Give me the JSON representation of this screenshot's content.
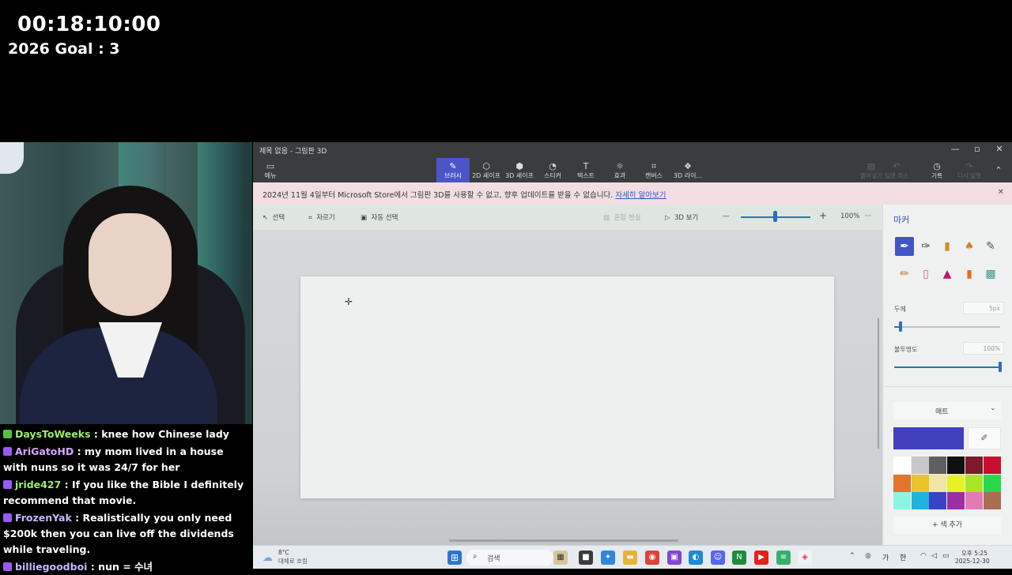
{
  "overlay": {
    "timer": "00:18:10:00",
    "goal": "2026 Goal : 3"
  },
  "chat": [
    {
      "user": "DaysToWeeks",
      "text": " : knee how Chinese lady",
      "user_color": "#9bf06b",
      "badge_color": "#52c33b"
    },
    {
      "user": "AriGatoHD",
      "text": " : my mom lived in a house with nuns so it was 24/7 for her",
      "user_color": "#d8a8ff",
      "badge_color": "#9b59f5"
    },
    {
      "user": "jride427",
      "text": " : If you like the Bible I definitely recommend that movie.",
      "user_color": "#9bf06b",
      "badge_color": "#9b59f5"
    },
    {
      "user": "FrozenYak",
      "text": " : Realistically you only need $200k then you can live off the dividends while traveling.",
      "user_color": "#c8b8ff",
      "badge_color": "#9b59f5"
    },
    {
      "user": "billiegoodboi",
      "text": " : nun = 수녀",
      "user_color": "#c8b8ff",
      "badge_color": "#9b59f5"
    }
  ],
  "window": {
    "title": "제목 없음 - 그림판 3D",
    "controls": {
      "minimize": "—",
      "maximize": "▫",
      "close": "✕"
    }
  },
  "toolbar": {
    "menu": {
      "label": "메뉴",
      "icon": "folder-icon"
    },
    "items": [
      {
        "label": "브러시",
        "icon": "brush-icon",
        "active": true
      },
      {
        "label": "2D 셰이프",
        "icon": "2d-shapes-icon",
        "active": false
      },
      {
        "label": "3D 셰이프",
        "icon": "3d-shapes-icon",
        "active": false
      },
      {
        "label": "스티커",
        "icon": "sticker-icon",
        "active": false
      },
      {
        "label": "텍스트",
        "icon": "text-icon",
        "active": false
      },
      {
        "label": "효과",
        "icon": "effects-icon",
        "active": false
      },
      {
        "label": "캔버스",
        "icon": "canvas-icon",
        "active": false
      },
      {
        "label": "3D 라이...",
        "icon": "3d-library-icon",
        "active": false
      }
    ],
    "right": [
      {
        "label": "붙여넣기",
        "icon": "paste-icon",
        "enabled": false
      },
      {
        "label": "실행 취소",
        "icon": "undo-icon",
        "enabled": false
      },
      {
        "label": "기록",
        "icon": "history-icon",
        "enabled": true
      },
      {
        "label": "다시 실행",
        "icon": "redo-icon",
        "enabled": false
      }
    ]
  },
  "banner": {
    "text": "2024년 11월 4일부터 Microsoft Store에서 그림판 3D를 사용할 수 없고, 향후 업데이트를 받을 수 없습니다.",
    "link": "자세히 알아보기",
    "close": "✕"
  },
  "subbar": {
    "select": "선택",
    "crop": "자르기",
    "magic_select": "자동 선택",
    "mixed_reality": "혼합 현실",
    "view_3d": "3D 보기",
    "zoom_minus": "—",
    "zoom_plus": "+",
    "zoom_value": "100%",
    "more": "···",
    "zoom_level": 0.5
  },
  "panel": {
    "title": "마커",
    "thickness_label": "두께",
    "thickness_value": "5px",
    "opacity_label": "불투명도",
    "opacity_value": "100%",
    "finish": "매트",
    "add_color": "+ 색 추가",
    "tools": [
      "marker-icon",
      "calligraphy-pen-icon",
      "oil-brush-icon",
      "watercolor-icon",
      "pixel-pen-icon",
      "pencil-icon",
      "eraser-icon",
      "crayon-icon",
      "spray-can-icon",
      "fill-bucket-icon"
    ],
    "selected_color": "#4240bc",
    "palette": [
      "#ffffff",
      "#c8c8c8",
      "#5f5f5f",
      "#101010",
      "#7d1a2a",
      "#c8102e",
      "#e2742b",
      "#e9c52b",
      "#eee5a6",
      "#e6f224",
      "#a6e627",
      "#29d84a",
      "#8ef4e2",
      "#1fb4e0",
      "#3843c7",
      "#9b2ea6",
      "#e27ab8",
      "#ab6d52"
    ]
  },
  "taskbar": {
    "weather_temp": "8°C",
    "weather_desc": "대체로 흐림",
    "search_placeholder": "검색",
    "time": "오후 5:25",
    "date": "2025-12-30",
    "ime_lang": "가",
    "ime_han": "한"
  }
}
